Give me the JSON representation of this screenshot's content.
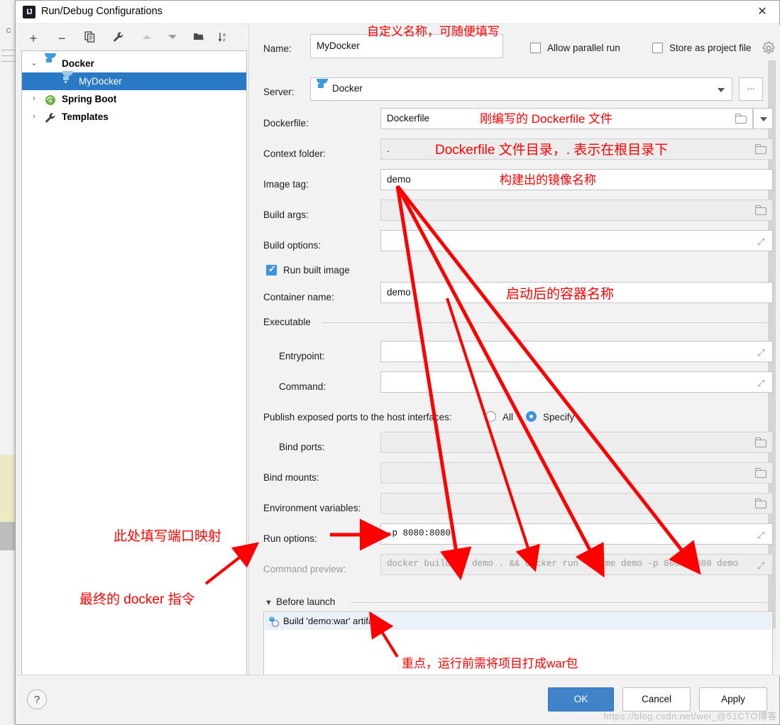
{
  "window": {
    "title": "Run/Debug Configurations",
    "app_icon": "intellij-idea-icon",
    "close_label": "✕"
  },
  "toolbar": {
    "items": [
      {
        "name": "add-configuration-button",
        "glyph": "+"
      },
      {
        "name": "remove-configuration-button",
        "glyph": "−"
      },
      {
        "name": "copy-configuration-button",
        "glyph": "❐"
      },
      {
        "name": "edit-templates-button",
        "glyph": "🔧"
      },
      {
        "name": "move-up-button",
        "glyph": "▲"
      },
      {
        "name": "move-down-button",
        "glyph": "▼"
      },
      {
        "name": "new-folder-button",
        "glyph": "❐"
      },
      {
        "name": "sort-alphabetically-button",
        "glyph": "↓"
      }
    ]
  },
  "tree": {
    "nodes": [
      {
        "label": "Docker",
        "icon": "docker-whale-icon",
        "expanded": true,
        "selected": false,
        "level": 0,
        "chevron": "⌄"
      },
      {
        "label": "MyDocker",
        "icon": "docker-whale-icon",
        "expanded": false,
        "selected": true,
        "level": 1,
        "chevron": ""
      },
      {
        "label": "Spring Boot",
        "icon": "spring-boot-icon",
        "expanded": false,
        "selected": false,
        "level": 0,
        "chevron": "›"
      },
      {
        "label": "Templates",
        "icon": "wrench-icon",
        "expanded": false,
        "selected": false,
        "level": 0,
        "chevron": "›"
      }
    ]
  },
  "form": {
    "name_label": "Name:",
    "name_value": "MyDocker",
    "allow_parallel_run_label": "Allow parallel run",
    "allow_parallel_run_checked": false,
    "store_as_project_file_label": "Store as project file",
    "store_as_project_file_checked": false,
    "gear_icon": "gear-icon",
    "server_label": "Server:",
    "server_value": "Docker",
    "server_more_label": "...",
    "dockerfile_label": "Dockerfile:",
    "dockerfile_value": "Dockerfile",
    "context_folder_label": "Context folder:",
    "context_folder_value": ".",
    "image_tag_label": "Image tag:",
    "image_tag_value": "demo",
    "build_args_label": "Build args:",
    "build_args_value": "",
    "build_options_label": "Build options:",
    "build_options_value": "",
    "run_built_image_label": "Run built image",
    "run_built_image_checked": true,
    "container_name_label": "Container name:",
    "container_name_value": "demo",
    "executable_section_label": "Executable",
    "entrypoint_label": "Entrypoint:",
    "entrypoint_value": "",
    "command_label": "Command:",
    "command_value": "",
    "publish_ports_label": "Publish exposed ports to the host interfaces:",
    "publish_all_label": "All",
    "publish_specify_label": "Specify",
    "publish_selected": "Specify",
    "bind_ports_label": "Bind ports:",
    "bind_ports_value": "",
    "bind_mounts_label": "Bind mounts:",
    "bind_mounts_value": "",
    "environment_variables_label": "Environment variables:",
    "environment_variables_value": "",
    "run_options_label": "Run options:",
    "run_options_value": "-p 8080:8080",
    "command_preview_label": "Command preview:",
    "command_preview_value": "docker build -t demo . && docker run --name demo -p 8080:8080 demo",
    "before_launch_label": "Before launch",
    "before_launch_items": [
      {
        "label": "Build 'demo:war' artifact",
        "icon": "artifact-icon"
      }
    ]
  },
  "buttons": {
    "help_label": "?",
    "ok_label": "OK",
    "cancel_label": "Cancel",
    "apply_label": "Apply"
  },
  "annotations": [
    {
      "id": "name-note",
      "text": "自定义名称，可随便填写"
    },
    {
      "id": "dockerfile-note",
      "text": "刚编写的 Dockerfile 文件"
    },
    {
      "id": "context-note",
      "text": "Dockerfile 文件目录，. 表示在根目录下"
    },
    {
      "id": "imagetag-note",
      "text": "构建出的镜像名称"
    },
    {
      "id": "container-note",
      "text": "启动后的容器名称"
    },
    {
      "id": "runopts-note",
      "text": "此处填写端口映射"
    },
    {
      "id": "preview-note",
      "text": "最终的 docker 指令"
    },
    {
      "id": "beforelaunch-note",
      "text": "重点，运行前需将项目打成war包"
    }
  ],
  "watermark": "https://blog.csdn.net/wei_@51CTO博客",
  "colors": {
    "accent": "#2a79c5",
    "checkbox_on": "#3d94e3",
    "annotation_red": "#ff0000",
    "ok_button": "#4083c9"
  }
}
